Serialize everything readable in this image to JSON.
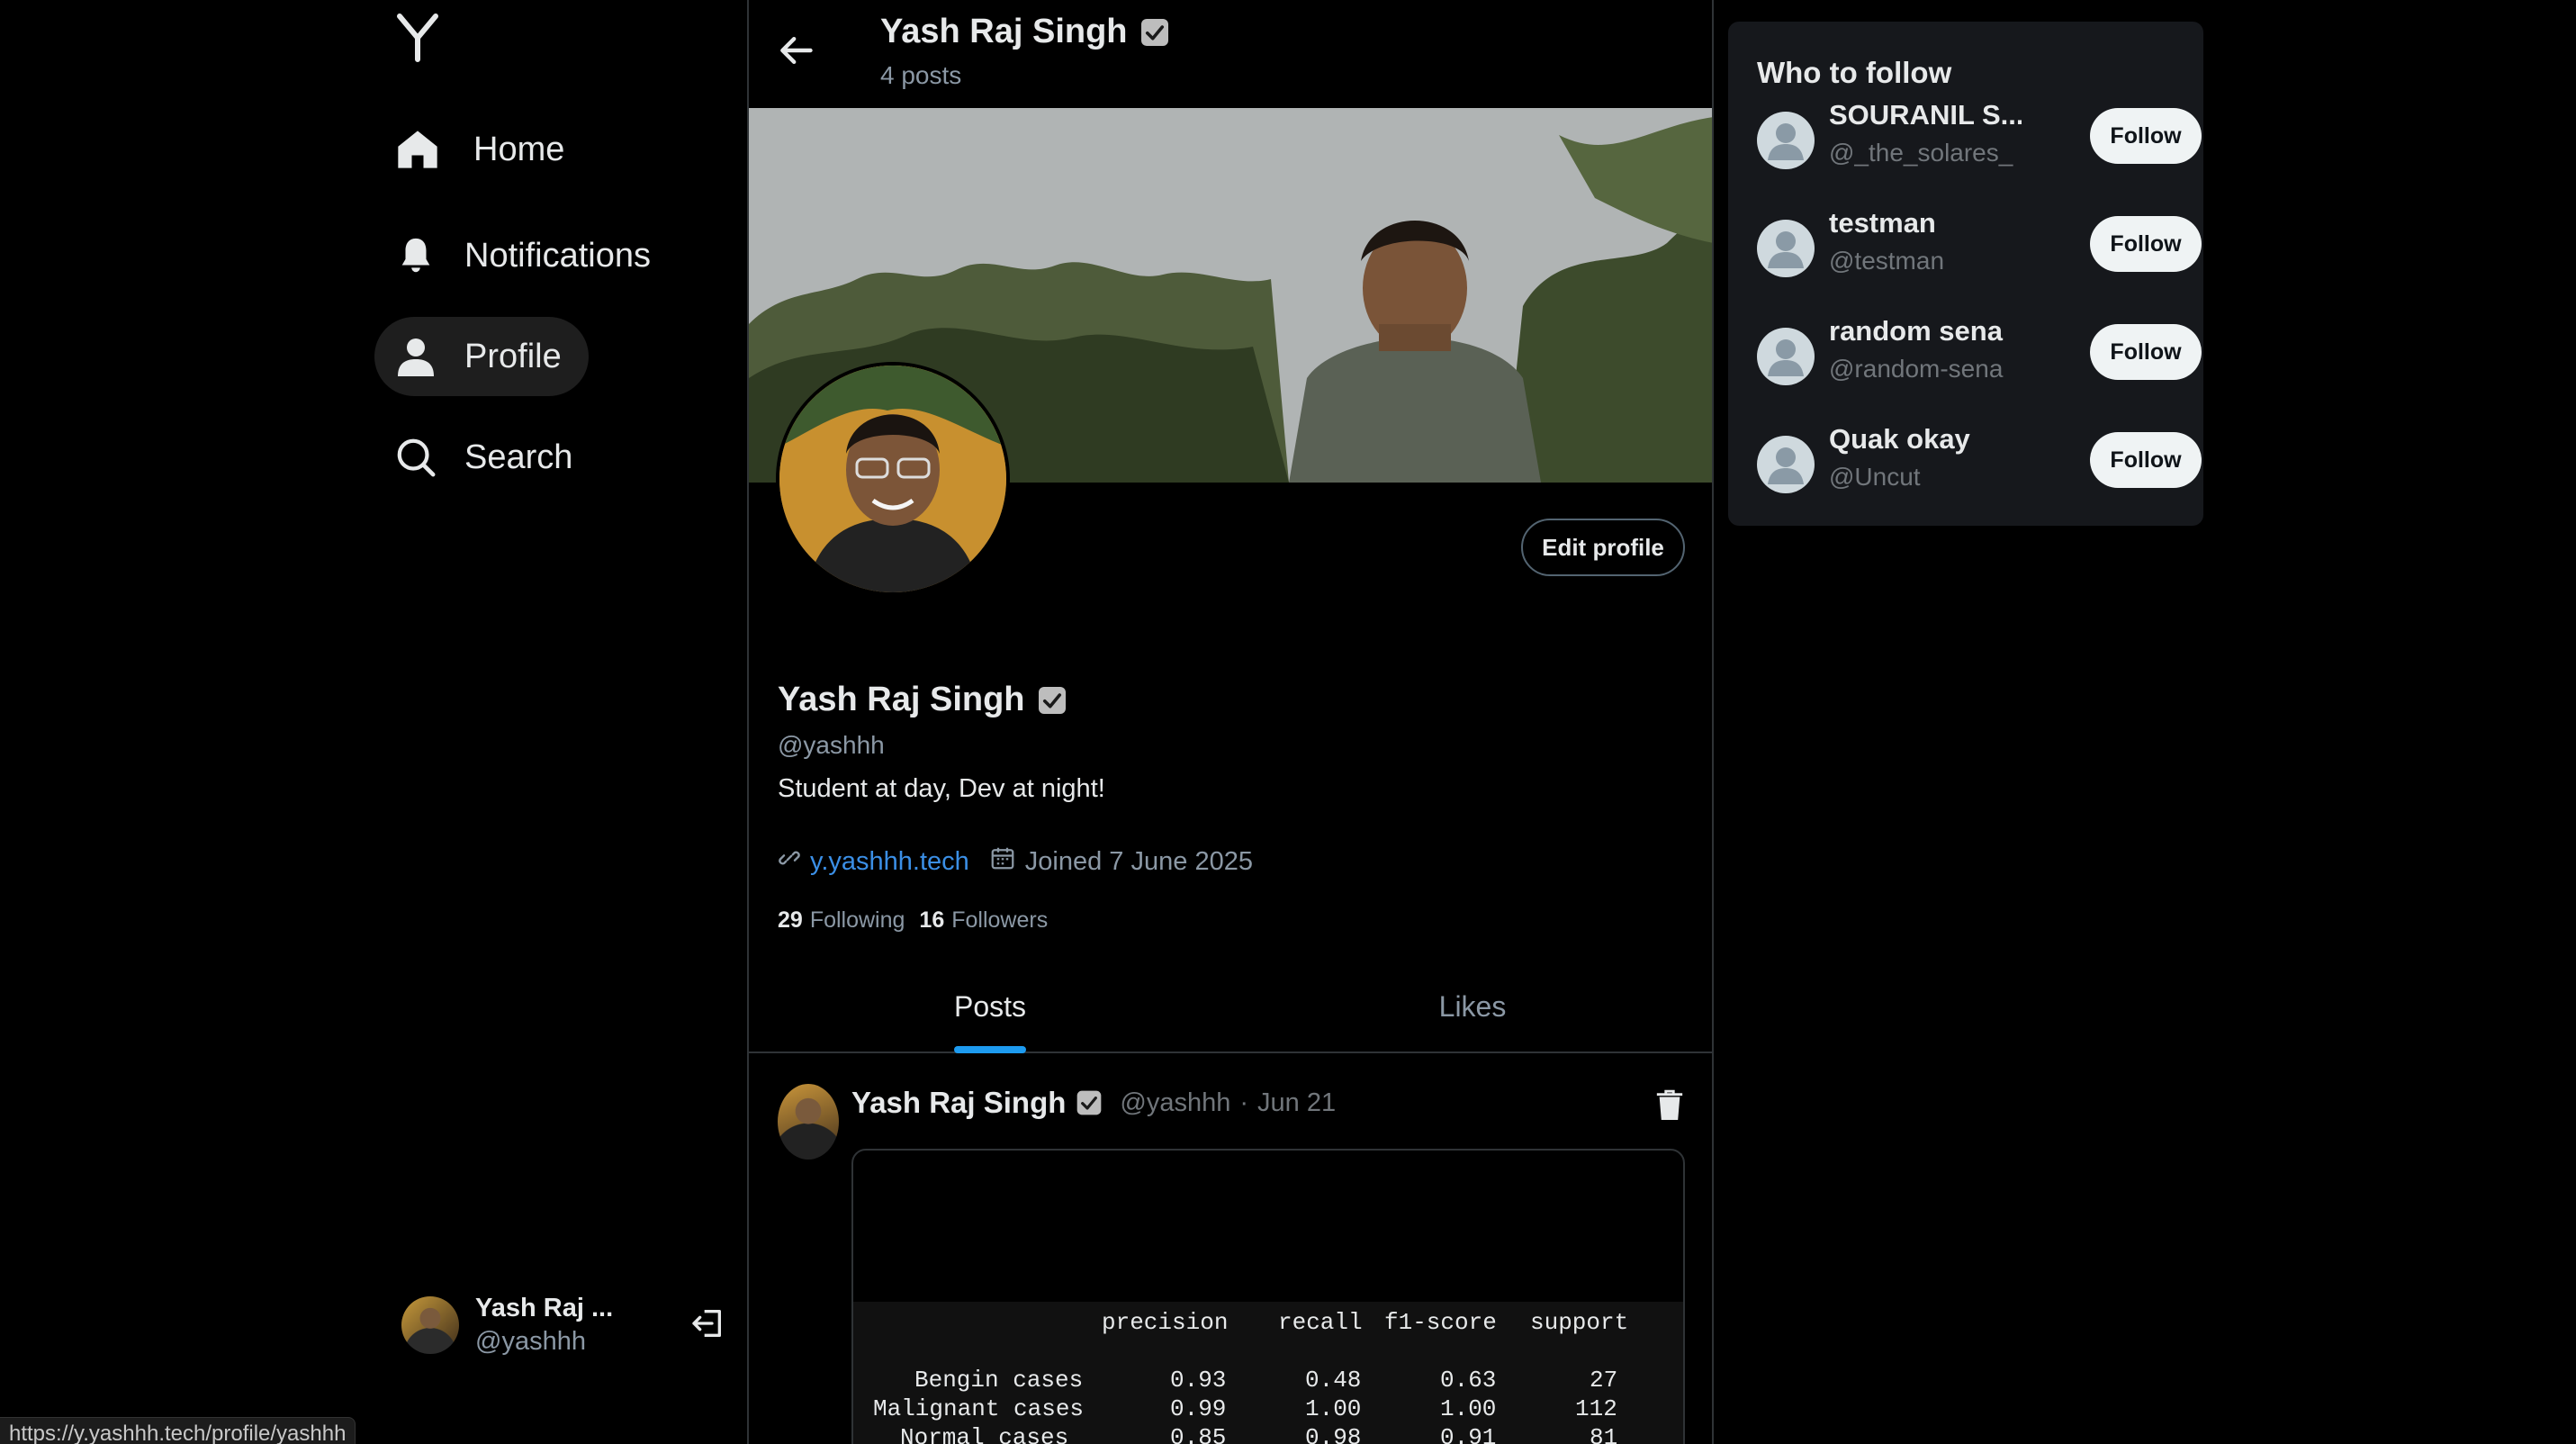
{
  "sidebar": {
    "items": [
      {
        "label": "Home",
        "icon": "home-icon"
      },
      {
        "label": "Notifications",
        "icon": "bell-icon"
      },
      {
        "label": "Profile",
        "icon": "person-icon",
        "active": true
      },
      {
        "label": "Search",
        "icon": "search-icon"
      }
    ],
    "account": {
      "name": "Yash Raj ...",
      "handle": "@yashhh"
    }
  },
  "status_bar": {
    "url": "https://y.yashhh.tech/profile/yashhh"
  },
  "header": {
    "name": "Yash Raj Singh",
    "posts_count": "4 posts"
  },
  "profile": {
    "name": "Yash Raj Singh",
    "handle": "@yashhh",
    "bio": "Student at day, Dev at night!",
    "website": "y.yashhh.tech",
    "joined": "Joined 7 June 2025",
    "following_count": "29",
    "following_label": "Following",
    "followers_count": "16",
    "followers_label": "Followers",
    "edit_label": "Edit profile"
  },
  "tabs": [
    {
      "label": "Posts",
      "active": true
    },
    {
      "label": "Likes",
      "active": false
    }
  ],
  "post": {
    "author": "Yash Raj Singh",
    "handle": "@yashhh",
    "separator": "·",
    "date": "Jun 21",
    "report": {
      "header": [
        "precision",
        "recall",
        "f1-score",
        "support"
      ],
      "rows": [
        {
          "label": "Bengin cases",
          "values": [
            "0.93",
            "0.48",
            "0.63",
            "27"
          ]
        },
        {
          "label": "Malignant cases",
          "values": [
            "0.99",
            "1.00",
            "1.00",
            "112"
          ]
        },
        {
          "label": "Normal cases",
          "values": [
            "0.85",
            "0.98",
            "0.91",
            "81"
          ]
        }
      ]
    }
  },
  "who_to_follow": {
    "title": "Who to follow",
    "button_label": "Follow",
    "users": [
      {
        "name": "SOURANIL S...",
        "handle": "@_the_solares_"
      },
      {
        "name": "testman",
        "handle": "@testman"
      },
      {
        "name": "random sena",
        "handle": "@random-sena"
      },
      {
        "name": "Quak okay",
        "handle": "@Uncut"
      }
    ]
  },
  "colors": {
    "background": "#000000",
    "link": "#3b8fe6",
    "accent": "#1d9bf0",
    "panel": "#16181c",
    "muted": "#8b98a5"
  }
}
